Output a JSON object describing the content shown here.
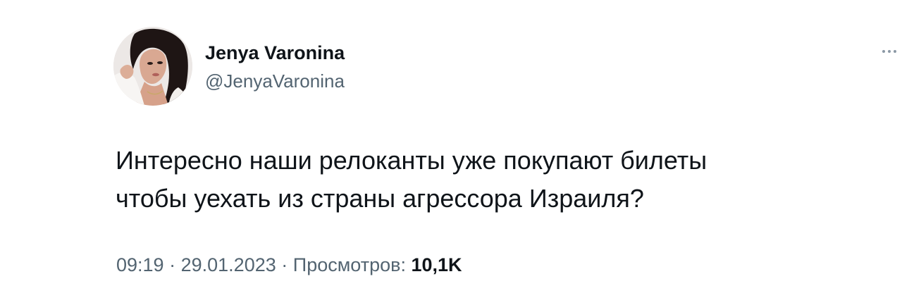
{
  "author": {
    "display_name": "Jenya Varonina",
    "handle": "@JenyaVaronina",
    "avatar": "profile-photo"
  },
  "tweet": {
    "lines": [
      "Интересно наши релоканты уже покупают билеты",
      "чтобы уехать из страны агрессора Израиля?"
    ]
  },
  "meta": {
    "time": "09:19",
    "separator": "·",
    "date": "29.01.2023",
    "views_label": "Просмотров:",
    "views_count": "10,1K"
  },
  "icons": {
    "more": "more-options-icon"
  },
  "colors": {
    "text_primary": "#0f1419",
    "text_secondary": "#536471",
    "background": "#ffffff"
  }
}
